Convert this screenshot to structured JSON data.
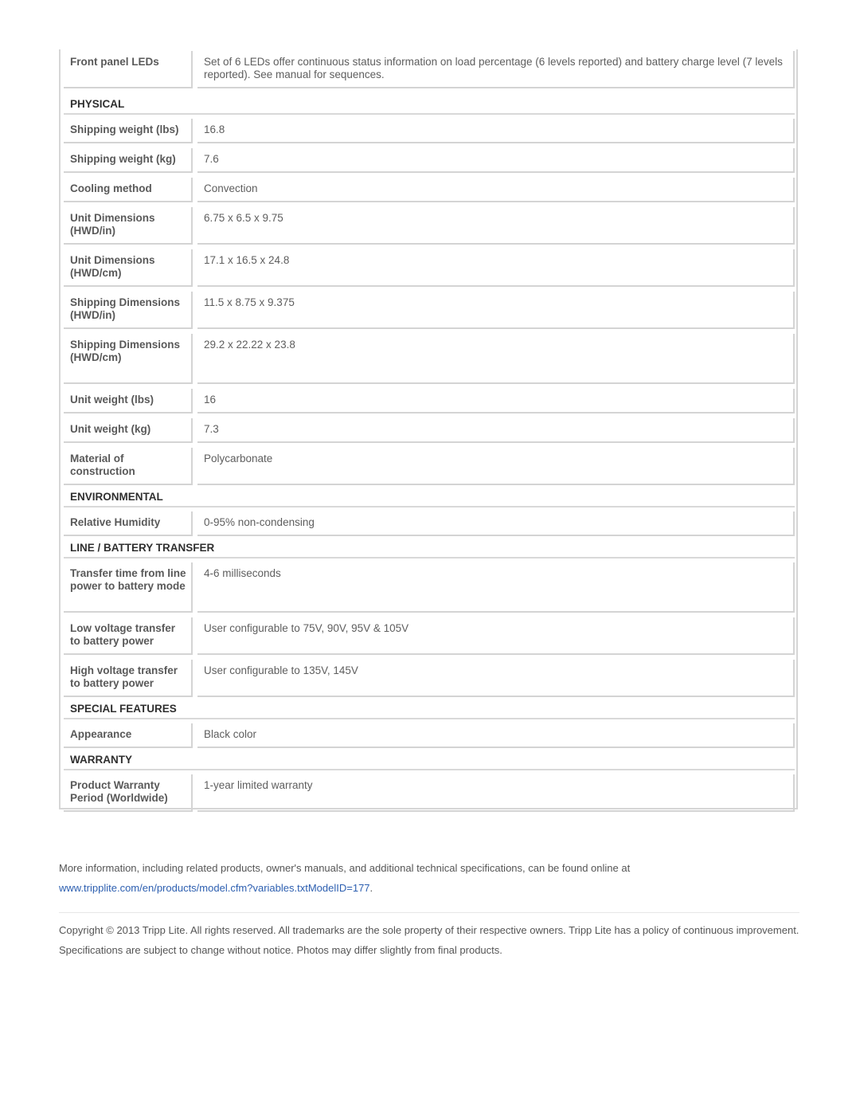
{
  "spec_table": {
    "rows": [
      {
        "type": "row",
        "label": "Front panel LEDs",
        "value": "Set of 6 LEDs offer continuous status information on load percentage (6 levels reported) and battery charge level (7 levels reported). See manual for sequences."
      },
      {
        "type": "section",
        "title": "PHYSICAL"
      },
      {
        "type": "row",
        "label": "Shipping weight (lbs)",
        "value": "16.8"
      },
      {
        "type": "row",
        "label": "Shipping weight (kg)",
        "value": "7.6"
      },
      {
        "type": "row",
        "label": "Cooling method",
        "value": "Convection"
      },
      {
        "type": "row",
        "label": "Unit Dimensions (HWD/in)",
        "value": "6.75 x 6.5 x 9.75"
      },
      {
        "type": "row",
        "label": "Unit Dimensions (HWD/cm)",
        "value": "17.1 x 16.5 x 24.8"
      },
      {
        "type": "row",
        "label": "Shipping Dimensions (HWD/in)",
        "value": "11.5 x 8.75 x 9.375"
      },
      {
        "type": "row",
        "label": "Shipping Dimensions (HWD/cm)",
        "value": "29.2 x 22.22 x 23.8"
      },
      {
        "type": "row",
        "label": "Unit weight (lbs)",
        "value": "16"
      },
      {
        "type": "row",
        "label": "Unit weight (kg)",
        "value": "7.3"
      },
      {
        "type": "row",
        "label": "Material of construction",
        "value": "Polycarbonate"
      },
      {
        "type": "section",
        "title": "ENVIRONMENTAL"
      },
      {
        "type": "row",
        "label": "Relative Humidity",
        "value": "0-95% non-condensing"
      },
      {
        "type": "section",
        "title": "LINE / BATTERY TRANSFER"
      },
      {
        "type": "row",
        "label": "Transfer time from line power to battery mode",
        "value": "4-6 milliseconds"
      },
      {
        "type": "row",
        "label": "Low voltage transfer to battery power",
        "value": "User configurable to 75V, 90V, 95V & 105V"
      },
      {
        "type": "row",
        "label": "High voltage transfer to battery power",
        "value": "User configurable to 135V, 145V"
      },
      {
        "type": "section",
        "title": "SPECIAL FEATURES"
      },
      {
        "type": "row",
        "label": "Appearance",
        "value": "Black color"
      },
      {
        "type": "section",
        "title": "WARRANTY"
      },
      {
        "type": "row",
        "label": "Product Warranty Period (Worldwide)",
        "value": "1-year limited warranty"
      }
    ]
  },
  "footer": {
    "more_info_text": "More information, including related products, owner's manuals, and additional technical specifications, can be found online at",
    "link_text": "www.tripplite.com/en/products/model.cfm?variables.txtModelID=177",
    "link_suffix": ".",
    "copyright": "Copyright © 2013 Tripp Lite. All rights reserved. All trademarks are the sole property of their respective owners. Tripp Lite has a policy of continuous improvement. Specifications are subject to change without notice. Photos may differ slightly from final products."
  },
  "colors": {
    "link": "#2d5fb0",
    "border": "#d4d4d4",
    "section_text": "#2f2f2f",
    "body_text": "#555555"
  }
}
